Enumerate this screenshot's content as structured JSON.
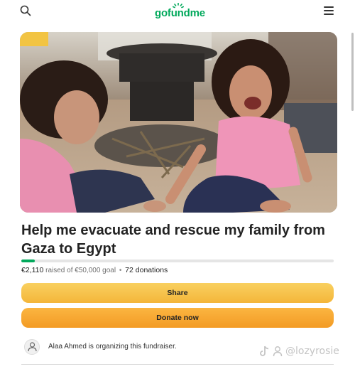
{
  "header": {
    "logo_text": "gofundme",
    "search_icon": "search-icon",
    "menu_icon": "hamburger-menu-icon",
    "brand_color": "#02a95c"
  },
  "campaign": {
    "title": "Help me evacuate and rescue my family from Gaza to Egypt",
    "image_description": "",
    "raised_amount": "€2,110",
    "raised_label": "raised of €50,000 goal",
    "separator": "•",
    "donations": "72 donations",
    "progress_percent": 4.22
  },
  "actions": {
    "share_label": "Share",
    "donate_label": "Donate now"
  },
  "organizer": {
    "text": "Alaa Ahmed is organizing this fundraiser.",
    "avatar_icon": "person-icon"
  },
  "watermark": {
    "text": "@lozyrosie",
    "icon": "tiktok-icon"
  },
  "colors": {
    "share_button": "#f6c24a",
    "donate_button": "#f6a82f",
    "progress_fill": "#02a95c"
  }
}
